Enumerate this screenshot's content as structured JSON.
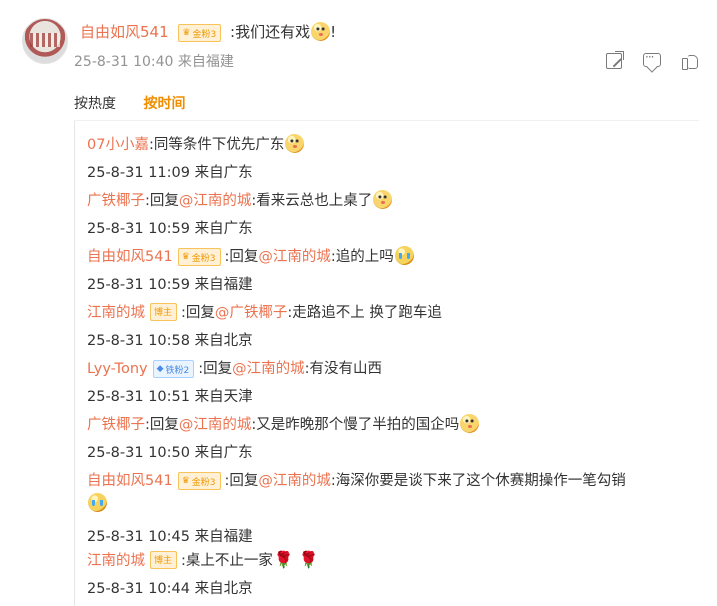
{
  "post": {
    "user": "自由如风541",
    "badge": "金粉3",
    "text": ":我们还有戏",
    "suffix": "!",
    "time": "25-8-31 10:40 来自福建"
  },
  "icons": {
    "share": "share-icon",
    "comment": "comment-icon",
    "like": "like-icon"
  },
  "sort": {
    "hot": "按热度",
    "time": "按时间",
    "active": "按时间"
  },
  "replies": [
    {
      "user": "07小小嘉",
      "parts": [
        {
          "text": ":同等条件下优先广东"
        }
      ],
      "emoji": "cat",
      "time": "25-8-31 11:09 来自广东"
    },
    {
      "user": "广铁椰子",
      "parts": [
        {
          "text": ":回复"
        },
        {
          "user": "@江南的城"
        },
        {
          "text": ":看来云总也上桌了"
        }
      ],
      "emoji": "cat",
      "time": "25-8-31 10:59 来自广东"
    },
    {
      "user": "自由如风541",
      "badge": "金粉3",
      "parts": [
        {
          "text": ":回复"
        },
        {
          "user": "@江南的城"
        },
        {
          "text": ":追的上吗"
        }
      ],
      "emoji": "cry",
      "time": "25-8-31 10:59 来自福建"
    },
    {
      "user": "江南的城",
      "badge": "博主",
      "parts": [
        {
          "text": ":回复"
        },
        {
          "user": "@广铁椰子"
        },
        {
          "text": ":走路追不上  换了跑车追"
        }
      ],
      "time": "25-8-31 10:58 来自北京"
    },
    {
      "user": "Lyy-Tony",
      "badge": "铁粉2",
      "parts": [
        {
          "text": ":回复"
        },
        {
          "user": "@江南的城"
        },
        {
          "text": ":有没有山西"
        }
      ],
      "time": "25-8-31 10:51 来自天津"
    },
    {
      "user": "广铁椰子",
      "parts": [
        {
          "text": ":回复"
        },
        {
          "user": "@江南的城"
        },
        {
          "text": ":又是昨晚那个慢了半拍的国企吗"
        }
      ],
      "emoji": "cat",
      "time": "25-8-31 10:50 来自广东"
    },
    {
      "user": "自由如风541",
      "badge": "金粉3",
      "parts": [
        {
          "text": ":回复"
        },
        {
          "user": "@江南的城"
        },
        {
          "text": ":海深你要是谈下来了这个休赛期操作一笔勾销"
        }
      ],
      "emoji": "cry",
      "time": "25-8-31 10:45 来自福建"
    },
    {
      "user": "江南的城",
      "badge": "博主",
      "parts": [
        {
          "text": ":桌上不止一家"
        }
      ],
      "roses": "🌹 🌹",
      "time": "25-8-31 10:44 来自北京"
    }
  ]
}
